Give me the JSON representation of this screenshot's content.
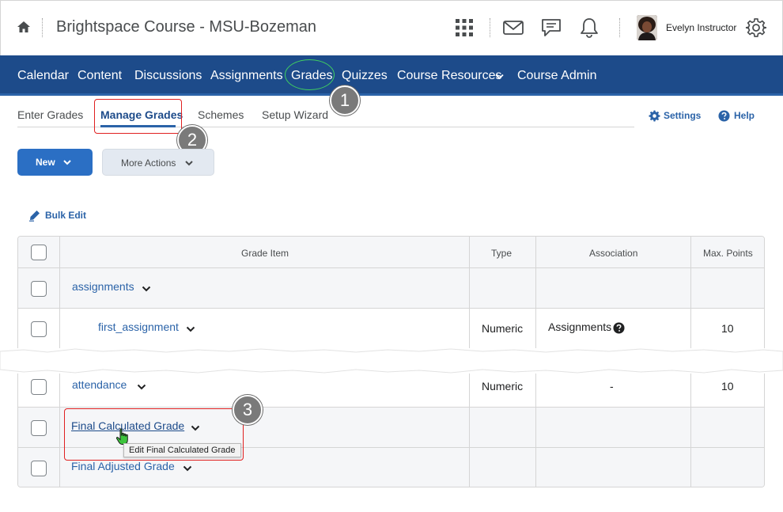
{
  "header": {
    "course_title": "Brightspace Course - MSU-Bozeman",
    "user_name": "Evelyn Instructor",
    "icons": [
      "home-icon",
      "waffle-grid-icon",
      "mail-icon",
      "chat-icon",
      "bell-icon",
      "avatar",
      "gear-icon"
    ]
  },
  "navbar": {
    "items": [
      "Calendar",
      "Content",
      "Discussions",
      "Assignments",
      "Grades",
      "Quizzes",
      "Course Resources",
      "Course Admin"
    ],
    "background": "#1d4b8a"
  },
  "tabs": {
    "items": [
      "Enter Grades",
      "Manage Grades",
      "Schemes",
      "Setup Wizard"
    ],
    "active": "Manage Grades"
  },
  "utility": {
    "settings_label": "Settings",
    "help_label": "Help"
  },
  "buttons": {
    "new_label": "New",
    "more_actions_label": "More Actions",
    "bulk_edit_label": "Bulk Edit"
  },
  "table": {
    "columns": [
      "Grade Item",
      "Type",
      "Association",
      "Max. Points"
    ],
    "rows": [
      {
        "name": "assignments",
        "type": "",
        "association": "",
        "max_points": ""
      },
      {
        "name": "first_assignment",
        "type": "Numeric",
        "association": "Assignments",
        "max_points": "10"
      },
      {
        "name": "attendance",
        "type": "Numeric",
        "association": "-",
        "max_points": "10"
      },
      {
        "name": "Final Calculated Grade",
        "type": "",
        "association": "",
        "max_points": ""
      },
      {
        "name": "Final Adjusted Grade",
        "type": "",
        "association": "",
        "max_points": ""
      }
    ]
  },
  "tooltip": "Edit Final Calculated Grade",
  "callouts": [
    "1",
    "2",
    "3"
  ],
  "colors": {
    "accent": "#2b63a8",
    "highlight_red": "#e02020",
    "highlight_green": "#40d060"
  }
}
